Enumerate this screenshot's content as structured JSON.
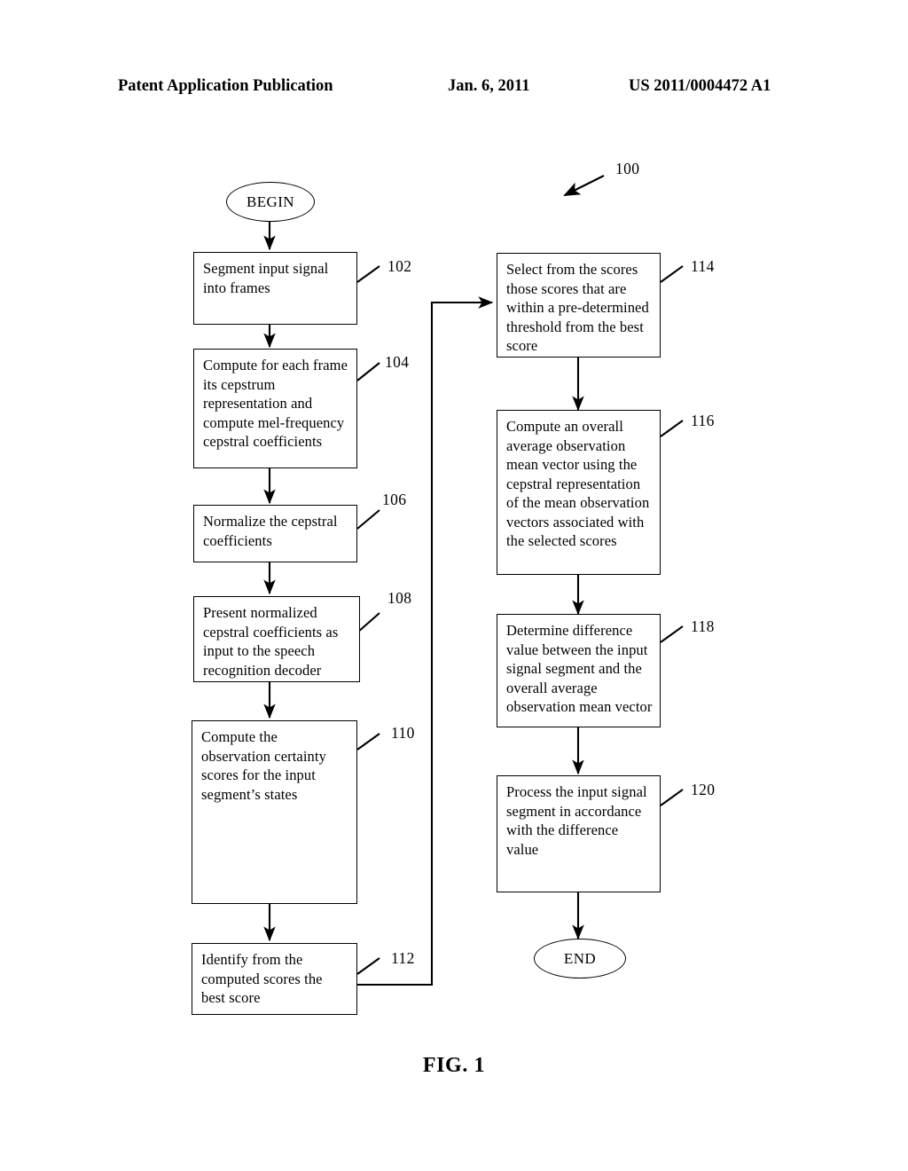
{
  "header": {
    "left": "Patent Application Publication",
    "middle": "Jan. 6, 2011",
    "right": "US 2011/0004472 A1"
  },
  "figure": {
    "caption": "FIG. 1",
    "diagram_ref": "100"
  },
  "terminators": {
    "begin": "BEGIN",
    "end": "END"
  },
  "nodes": [
    {
      "ref": "102",
      "text": "Segment input signal into frames"
    },
    {
      "ref": "104",
      "text": "Compute for each frame its cepstrum representation and compute mel-frequency cepstral coefficients"
    },
    {
      "ref": "106",
      "text": "Normalize the cepstral coefficients"
    },
    {
      "ref": "108",
      "text": "Present normalized cepstral coefficients as input to the speech recognition decoder"
    },
    {
      "ref": "110",
      "text": "Compute the observation certainty scores for the input segment’s states"
    },
    {
      "ref": "112",
      "text": "Identify from the computed scores the best score"
    },
    {
      "ref": "114",
      "text": "Select from the scores those scores that are within a pre-determined threshold from the best score"
    },
    {
      "ref": "116",
      "text": "Compute an overall average observation mean vector using the cepstral representation of the mean observation vectors associated with the selected scores"
    },
    {
      "ref": "118",
      "text": "Determine difference value between the input signal segment and the overall average observation mean vector"
    },
    {
      "ref": "120",
      "text": "Process the input signal segment in accordance with the difference value"
    }
  ]
}
